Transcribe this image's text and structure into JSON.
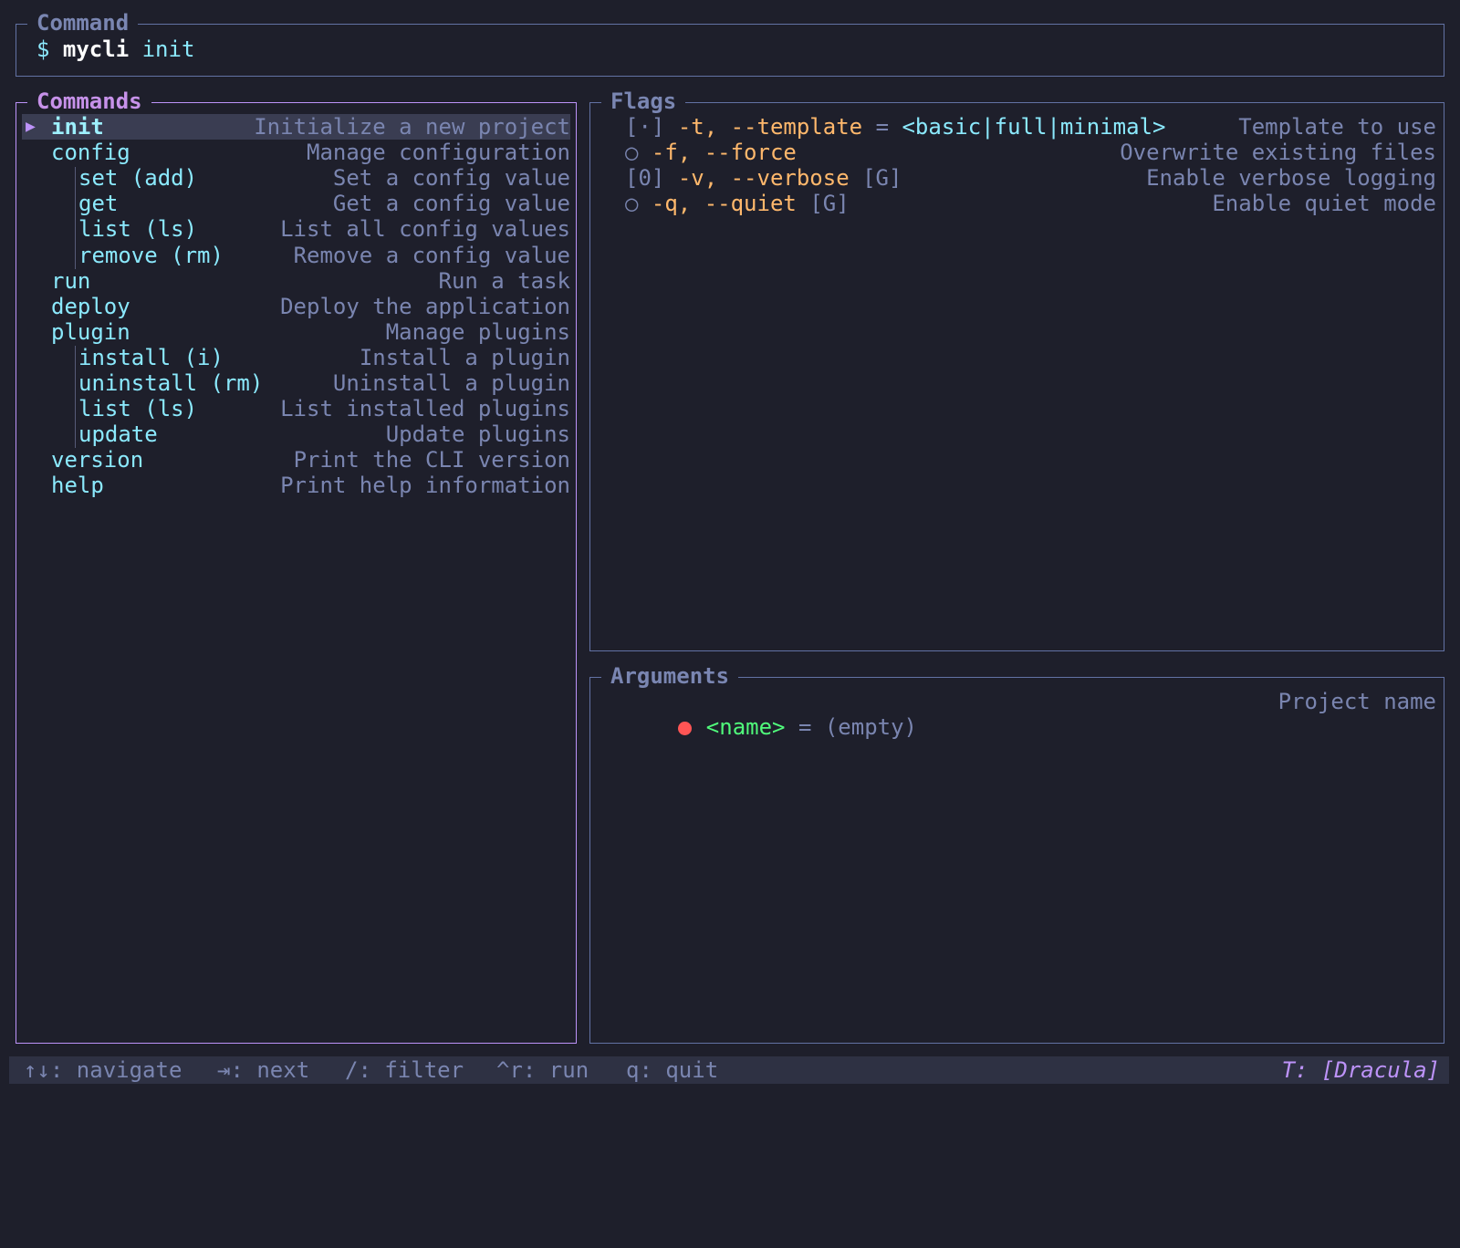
{
  "command_panel": {
    "title": "Command",
    "prompt": "$",
    "binary": "mycli",
    "subcommand": "init"
  },
  "commands_panel": {
    "title": "Commands",
    "selected_marker": "▶",
    "items": [
      {
        "name": "init",
        "description": "Initialize a new project",
        "level": 0,
        "selected": true
      },
      {
        "name": "config",
        "description": "Manage configuration",
        "level": 0
      },
      {
        "name": "set (add)",
        "description": "Set a config value",
        "level": 1
      },
      {
        "name": "get",
        "description": "Get a config value",
        "level": 1
      },
      {
        "name": "list (ls)",
        "description": "List all config values",
        "level": 1
      },
      {
        "name": "remove (rm)",
        "description": "Remove a config value",
        "level": 1
      },
      {
        "name": "run",
        "description": "Run a task",
        "level": 0
      },
      {
        "name": "deploy",
        "description": "Deploy the application",
        "level": 0
      },
      {
        "name": "plugin",
        "description": "Manage plugins",
        "level": 0
      },
      {
        "name": "install (i)",
        "description": "Install a plugin",
        "level": 1
      },
      {
        "name": "uninstall (rm)",
        "description": "Uninstall a plugin",
        "level": 1
      },
      {
        "name": "list (ls)",
        "description": "List installed plugins",
        "level": 1
      },
      {
        "name": "update",
        "description": "Update plugins",
        "level": 1
      },
      {
        "name": "version",
        "description": "Print the CLI version",
        "level": 0
      },
      {
        "name": "help",
        "description": "Print help information",
        "level": 0
      }
    ]
  },
  "flags_panel": {
    "title": "Flags",
    "items": [
      {
        "state": "[·]",
        "name": "-t, --template",
        "eq": "=",
        "value": "<basic|full|minimal>",
        "global": "",
        "description": "Template to use"
      },
      {
        "state": "○",
        "name": "-f, --force",
        "eq": "",
        "value": "",
        "global": "",
        "description": "Overwrite existing files"
      },
      {
        "state": "[0]",
        "name": "-v, --verbose",
        "eq": "",
        "value": "",
        "global": "[G]",
        "description": "Enable verbose logging"
      },
      {
        "state": "○",
        "name": "-q, --quiet",
        "eq": "",
        "value": "",
        "global": "[G]",
        "description": "Enable quiet mode"
      }
    ]
  },
  "args_panel": {
    "title": "Arguments",
    "items": [
      {
        "name": "<name>",
        "eq": "=",
        "value": "(empty)",
        "description": "Project name",
        "required": true
      }
    ]
  },
  "status_bar": {
    "hints": [
      "↑↓: navigate",
      "⇥: next",
      "/: filter",
      "^r: run",
      "q: quit"
    ],
    "theme": "T: [Dracula]"
  },
  "colors": {
    "background": "#1e1f2b",
    "focused_border": "#bd93f9",
    "border": "#6272a4",
    "command": "#8be9fd",
    "flag": "#ffb86c",
    "argument": "#50fa7b",
    "required_dot": "#ff5555",
    "muted": "#7a85b0"
  }
}
